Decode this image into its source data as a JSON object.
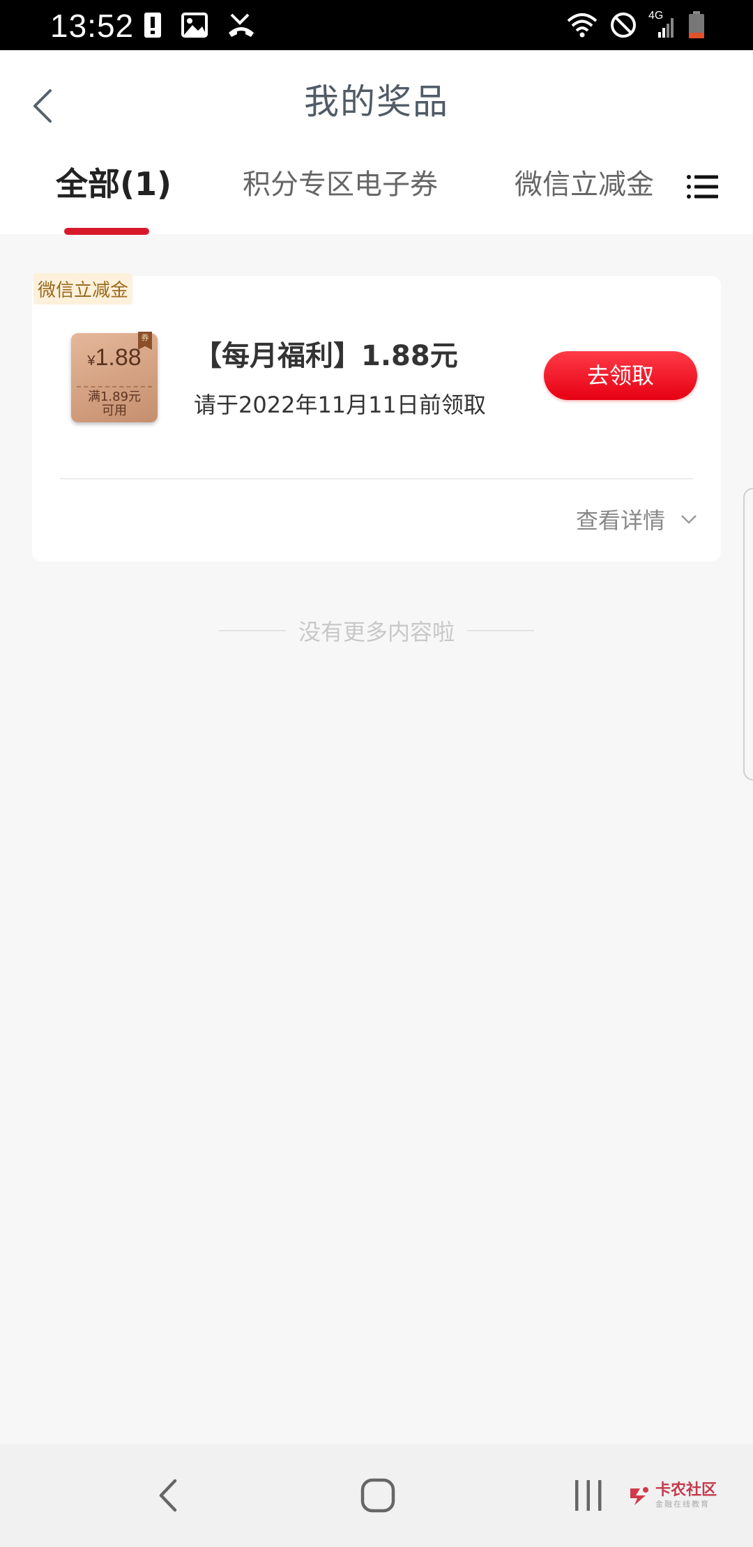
{
  "status_bar": {
    "time": "13:52",
    "network_label": "4G",
    "left_icons": [
      "alert-icon",
      "image-icon",
      "missed-call-icon"
    ],
    "right_icons": [
      "wifi-icon",
      "do-not-disturb-icon",
      "signal-icon",
      "battery-icon"
    ]
  },
  "header": {
    "title": "我的奖品",
    "back_icon": "chevron-left-icon"
  },
  "tabs": [
    {
      "label": "全部(1)",
      "active": true
    },
    {
      "label": "积分专区电子券",
      "active": false
    },
    {
      "label": "微信立减金(",
      "active": false
    }
  ],
  "menu_icon": "list-menu-icon",
  "prize_card": {
    "tag": "微信立减金",
    "coupon": {
      "currency": "¥",
      "amount": "1.88",
      "condition_line1": "满1.89元",
      "condition_line2": "可用",
      "ribbon": "券"
    },
    "title": "【每月福利】1.88元",
    "deadline": "请于2022年11月11日前领取",
    "claim_button": "去领取",
    "detail_link": "查看详情"
  },
  "footer_text": "没有更多内容啦",
  "nav_bar": {
    "items": [
      "back-nav-icon",
      "home-nav-icon",
      "recents-nav-icon"
    ],
    "watermark_title": "卡农社区",
    "watermark_subtitle": "金融在线教育"
  },
  "colors": {
    "accent_red": "#d8192c",
    "button_red": "#e60012",
    "tag_bg": "#fdf1dc",
    "coupon_bronze": "#c58f6e"
  }
}
